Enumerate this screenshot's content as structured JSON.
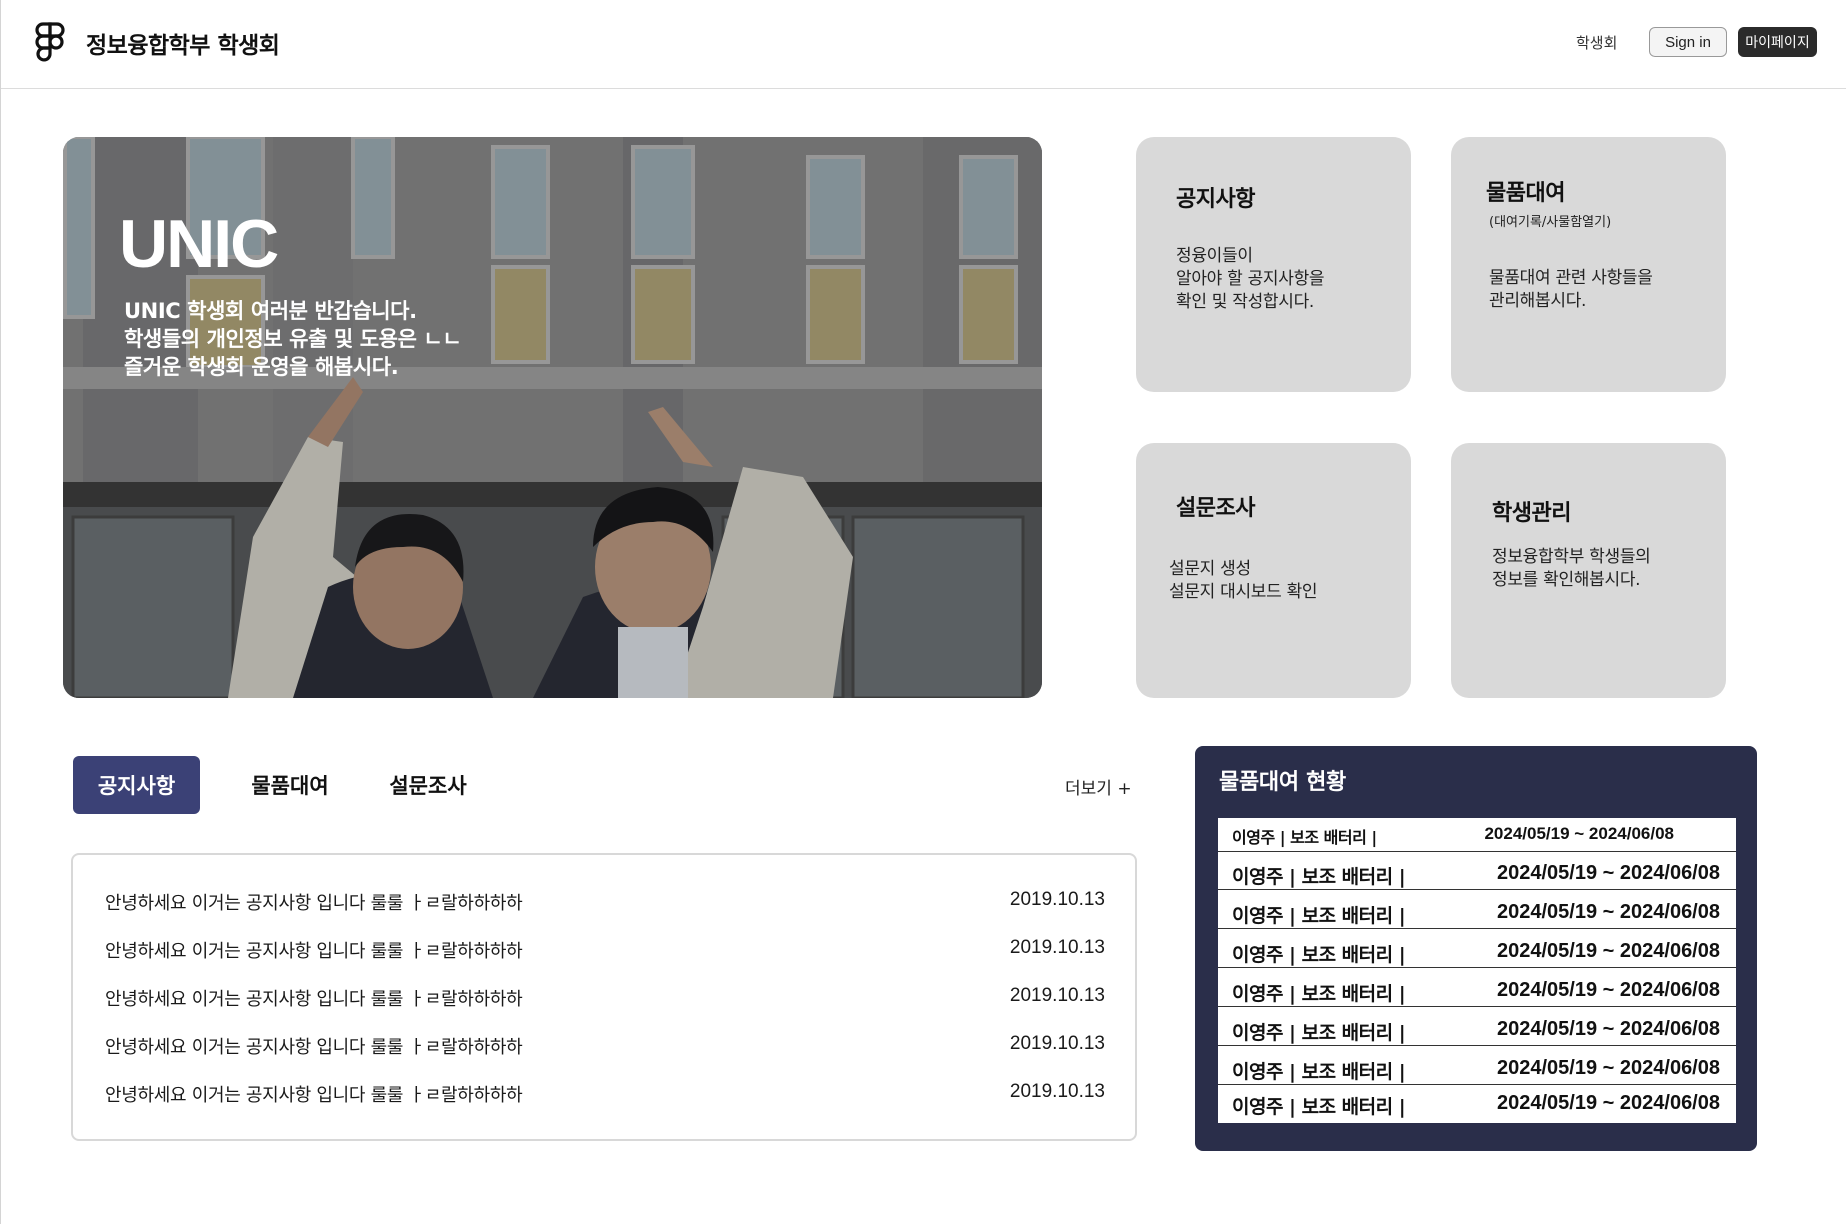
{
  "header": {
    "brand": "정보융합학부 학생회",
    "nav_link": "학생회",
    "signin_label": "Sign in",
    "mypage_label": "마이페이지",
    "logo_icon": "figma-logo-icon"
  },
  "hero": {
    "title": "UNIC",
    "lines": [
      "UNIC 학생회 여러분 반갑습니다.",
      "학생들의 개인정보 유출 및 도용은 ㄴㄴ",
      "즐거운 학생회 운영을 해봅시다."
    ]
  },
  "cards": [
    {
      "title": "공지사항",
      "subtitle": "",
      "desc": [
        "정융이들이",
        "알아야 할 공지사항을",
        "확인 및 작성합시다."
      ]
    },
    {
      "title": "물품대여",
      "subtitle": "(대여기록/사물함열기)",
      "desc": [
        "물품대여 관련 사항들을",
        "관리해봅시다."
      ]
    },
    {
      "title": "설문조사",
      "subtitle": "",
      "desc": [
        "설문지 생성",
        "설문지 대시보드 확인"
      ]
    },
    {
      "title": "학생관리",
      "subtitle": "",
      "desc": [
        "정보융합학부 학생들의",
        "정보를 확인해봅시다."
      ]
    }
  ],
  "tabs": [
    {
      "label": "공지사항",
      "active": true
    },
    {
      "label": "물품대여",
      "active": false
    },
    {
      "label": "설문조사",
      "active": false
    }
  ],
  "more_label": "더보기 +",
  "notices": [
    {
      "title": "안녕하세요 이거는 공지사항 입니다 룰룰 ㅏㄹ랄하하하하",
      "date": "2019.10.13"
    },
    {
      "title": "안녕하세요 이거는 공지사항 입니다 룰룰 ㅏㄹ랄하하하하",
      "date": "2019.10.13"
    },
    {
      "title": "안녕하세요 이거는 공지사항 입니다 룰룰 ㅏㄹ랄하하하하",
      "date": "2019.10.13"
    },
    {
      "title": "안녕하세요 이거는 공지사항 입니다 룰룰 ㅏㄹ랄하하하하",
      "date": "2019.10.13"
    },
    {
      "title": "안녕하세요 이거는 공지사항 입니다 룰룰 ㅏㄹ랄하하하하",
      "date": "2019.10.13"
    }
  ],
  "rental": {
    "title": "물품대여 현황",
    "rows": [
      {
        "name": "이영주 | 보조 배터리 |",
        "period": "2024/05/19 ~ 2024/06/08"
      },
      {
        "name": "이영주 | 보조 배터리 |",
        "period": "2024/05/19 ~ 2024/06/08"
      },
      {
        "name": "이영주 | 보조 배터리 |",
        "period": "2024/05/19 ~ 2024/06/08"
      },
      {
        "name": "이영주 | 보조 배터리 |",
        "period": "2024/05/19 ~ 2024/06/08"
      },
      {
        "name": "이영주 | 보조 배터리 |",
        "period": "2024/05/19 ~ 2024/06/08"
      },
      {
        "name": "이영주 | 보조 배터리 |",
        "period": "2024/05/19 ~ 2024/06/08"
      },
      {
        "name": "이영주 | 보조 배터리 |",
        "period": "2024/05/19 ~ 2024/06/08"
      },
      {
        "name": "이영주 | 보조 배터리 |",
        "period": "2024/05/19 ~ 2024/06/08"
      }
    ]
  },
  "colors": {
    "active_tab": "#3b4176",
    "rental_panel": "#2a2e4a",
    "card_bg": "#d9d9d9",
    "mypage_button": "#2b2b2b"
  }
}
